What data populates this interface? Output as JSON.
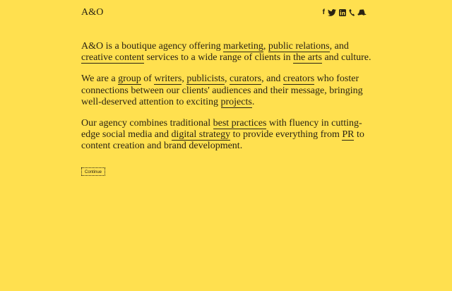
{
  "site": {
    "logo": "A&O",
    "social": [
      {
        "name": "facebook",
        "icon": "facebook-icon",
        "glyph": "f"
      },
      {
        "name": "twitter",
        "icon": "twitter-icon"
      },
      {
        "name": "linkedin",
        "icon": "linkedin-icon",
        "glyph": "in"
      },
      {
        "name": "phone",
        "icon": "phone-icon"
      },
      {
        "name": "new-york",
        "icon": "new-york-state-icon"
      }
    ]
  },
  "content": {
    "p1": {
      "t1": "A&O is a boutique agency offering ",
      "l1": "marketing",
      "t2": ", ",
      "l2": "public relations",
      "t3": ", and ",
      "l3": "creative content",
      "t4": " services to a wide range of clients in ",
      "l4": "the arts",
      "t5": " and culture."
    },
    "p2": {
      "t1": "We are a ",
      "l1": "group",
      "t2": " of ",
      "l2": "writers",
      "t3": ", ",
      "l3": "publicists",
      "t4": ", ",
      "l4": "curators",
      "t5": ", and ",
      "l5": "creators",
      "t6": " who foster connections between our clients' audiences and their message, bringing well-deserved attention to exciting ",
      "l6": "projects",
      "t7": "."
    },
    "p3": {
      "t1": "Our agency combines traditional ",
      "l1": "best practices",
      "t2": " with fluency in cutting-edge social media and ",
      "l2": "digital strategy",
      "t3": " to provide everything from ",
      "l3": "PR",
      "t4": " to content creation and brand development."
    }
  },
  "continue_button": "Continue",
  "colors": {
    "background": "#ffe04f",
    "text": "#2a2312"
  }
}
